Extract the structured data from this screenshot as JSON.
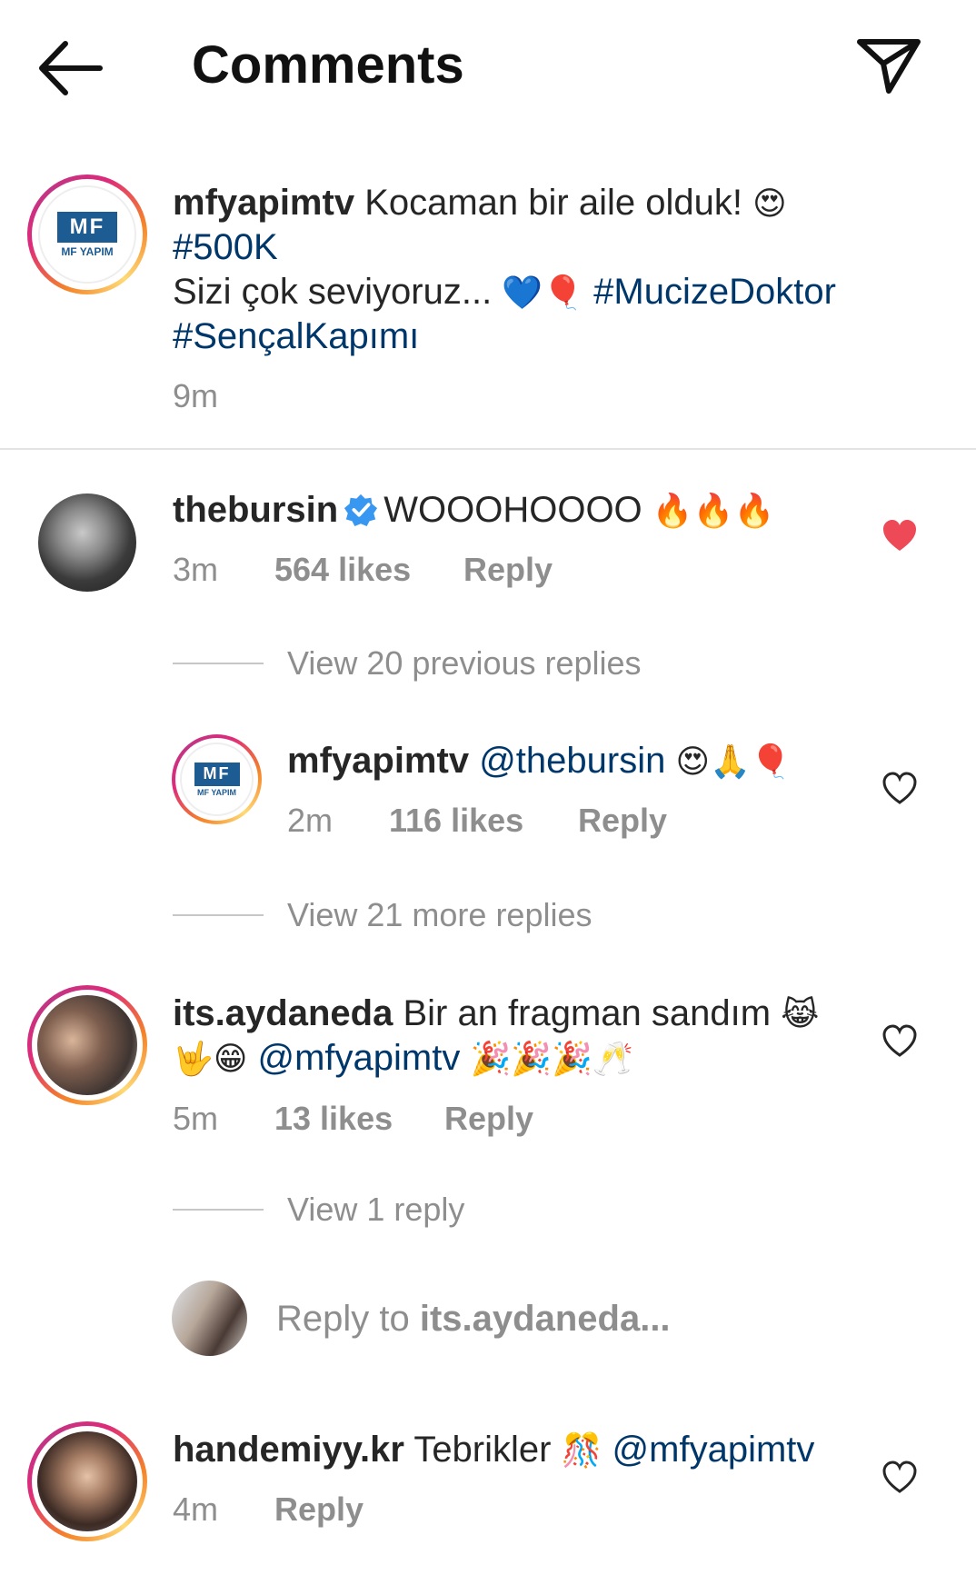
{
  "header": {
    "title": "Comments",
    "back_icon": "arrow-left-icon",
    "send_icon": "paper-plane-icon"
  },
  "caption": {
    "username": "mfyapimtv",
    "text": "Kocaman bir aile olduk!",
    "emoji_1": "😍",
    "tag_500k": "#500K",
    "line2_text": "Sizi çok seviyoruz...",
    "emoji_2": "💙🎈",
    "tag_mucize": "#MucizeDoktor",
    "tag_sencal": "#SençalKapımı",
    "time": "9m",
    "logo_text": "MF",
    "logo_caption": "MF YAPIM"
  },
  "comments": [
    {
      "username": "thebursin",
      "text": "WOOOHOOOO",
      "emoji": "🔥🔥🔥",
      "time": "3m",
      "likes": "564 likes",
      "reply": "Reply",
      "liked": true,
      "thread_label": "View 20 previous replies"
    },
    {
      "username": "mfyapimtv",
      "mention": "@thebursin",
      "emoji": "😍🙏🎈",
      "time": "2m",
      "likes": "116 likes",
      "reply": "Reply",
      "liked": false,
      "thread_label": "View 21 more replies"
    },
    {
      "username": "its.aydaneda",
      "text": "Bir an fragman sandım",
      "emoji_a": "😹",
      "emoji_b": "🤟😁",
      "mention": "@mfyapimtv",
      "emoji_c": "🎉🎉🎉🥂",
      "time": "5m",
      "likes": "13 likes",
      "reply": "Reply",
      "liked": false,
      "thread_label": "View 1 reply"
    },
    {
      "username": "handemiyy.kr",
      "text": "Tebrikler",
      "emoji": "🎊",
      "mention": "@mfyapimtv",
      "time": "4m",
      "reply": "Reply",
      "liked": false
    }
  ],
  "reply_box": {
    "prefix": "Reply to",
    "target": "its.aydaneda..."
  },
  "colors": {
    "heart_active": "#ed4956",
    "link": "#00376b",
    "meta": "#8e8e8e",
    "verified": "#3897f0"
  }
}
